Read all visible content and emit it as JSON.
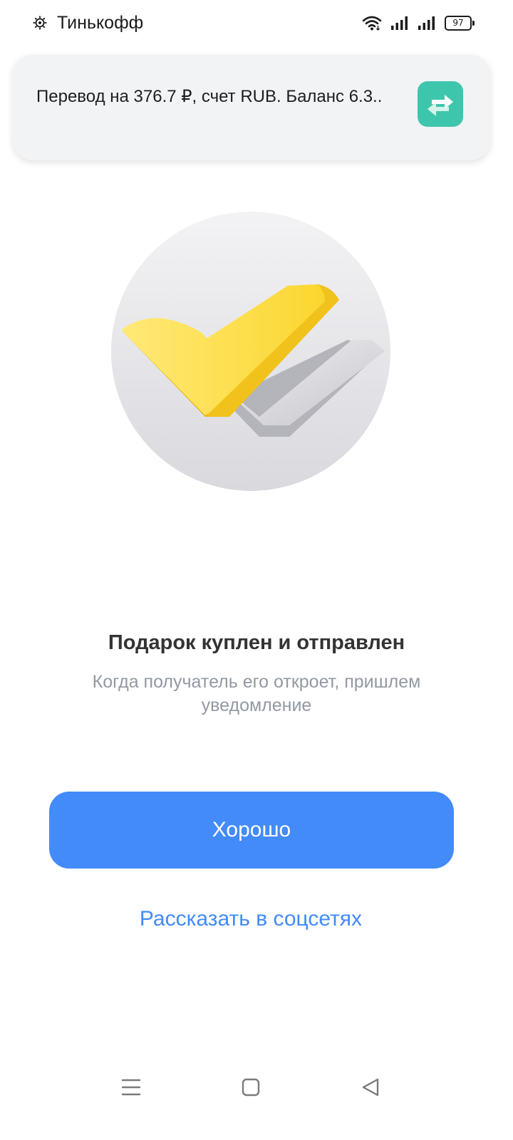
{
  "status_bar": {
    "app_name": "Тинькофф",
    "battery": "97"
  },
  "notification": {
    "text": "Перевод на 376.7 ₽, счет RUB. Баланс 6.3..",
    "icon": "transfer-arrows-icon",
    "icon_color": "#3ec6ad"
  },
  "illustration": {
    "icon": "double-checkmark-icon"
  },
  "message": {
    "title": "Подарок куплен и отправлен",
    "subtitle": "Когда получатель его откроет, пришлем уведомление"
  },
  "actions": {
    "ok_label": "Хорошо",
    "share_label": "Рассказать в соцсетях",
    "accent_color": "#428bf9"
  },
  "nav_bar": {
    "recents_icon": "menu-lines-icon",
    "home_icon": "square-home-icon",
    "back_icon": "triangle-back-icon"
  }
}
